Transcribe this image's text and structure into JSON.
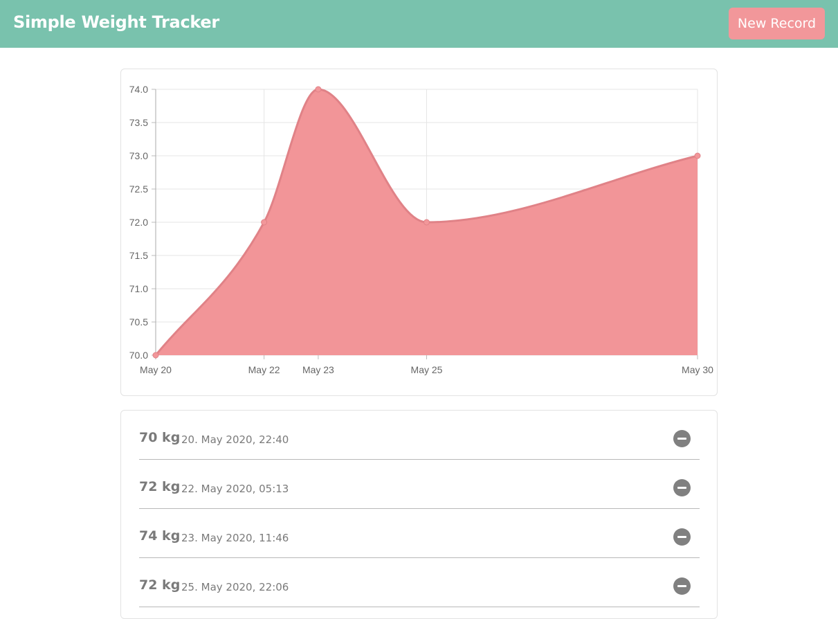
{
  "header": {
    "title": "Simple Weight Tracker",
    "new_record_label": "New Record"
  },
  "colors": {
    "header_bg": "#79c2ad",
    "accent": "#f2979a",
    "area_fill": "#f29598",
    "line": "#e08287"
  },
  "chart_data": {
    "type": "area",
    "x": [
      "May 20",
      "May 22",
      "May 23",
      "May 25",
      "May 30"
    ],
    "x_days": [
      20,
      22,
      23,
      25,
      30
    ],
    "values": [
      70,
      72,
      74,
      72,
      73
    ],
    "ylim": [
      70,
      74
    ],
    "yticks": [
      "74.0",
      "73.5",
      "73.0",
      "72.5",
      "72.0",
      "71.5",
      "71.0",
      "70.5",
      "70.0"
    ],
    "grid": true,
    "title": "",
    "xlabel": "",
    "ylabel": ""
  },
  "records": [
    {
      "weight": "70 kg",
      "date": "20. May 2020, 22:40"
    },
    {
      "weight": "72 kg",
      "date": "22. May 2020, 05:13"
    },
    {
      "weight": "74 kg",
      "date": "23. May 2020, 11:46"
    },
    {
      "weight": "72 kg",
      "date": "25. May 2020, 22:06"
    }
  ]
}
